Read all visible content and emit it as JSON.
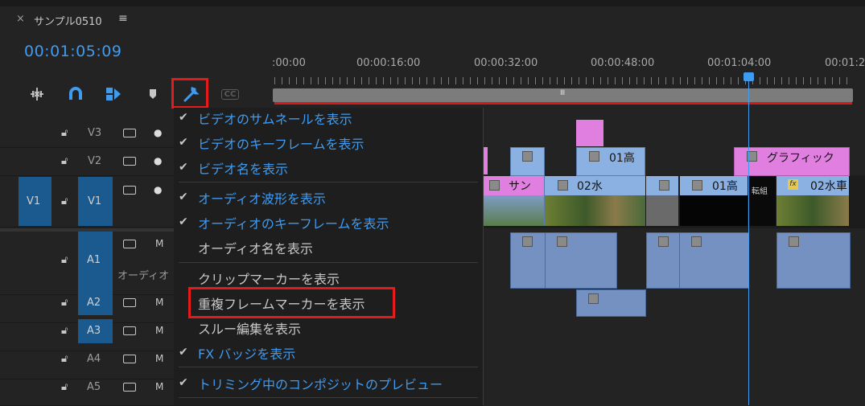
{
  "sequence_tab": {
    "close": "×",
    "title": "サンプル0510",
    "menu": "≡"
  },
  "timecode": "00:01:05:09",
  "ruler": {
    "labels": [
      ":00:00",
      "00:00:16:00",
      "00:00:32:00",
      "00:00:48:00",
      "00:01:04:00",
      "00:01:2"
    ],
    "scroll_grip": "Ⅲ"
  },
  "toolbar": {
    "snap": "snap-icon",
    "magnet": "magnet-icon",
    "linked": "linked-selection-icon",
    "marker": "add-marker-icon",
    "settings": "wrench-icon",
    "captions_label": "CC"
  },
  "tracks": {
    "video": [
      {
        "name": "V3"
      },
      {
        "name": "V2"
      },
      {
        "name": "V1",
        "source": "V1"
      }
    ],
    "audio": [
      {
        "name": "A1",
        "m": "M",
        "label": "オーディオ"
      },
      {
        "name": "A2",
        "m": "M"
      },
      {
        "name": "A3",
        "m": "M"
      },
      {
        "name": "A4",
        "m": "M"
      },
      {
        "name": "A5",
        "m": "M"
      }
    ]
  },
  "settings_menu": {
    "items": [
      {
        "label": "ビデオのサムネールを表示",
        "checked": true
      },
      {
        "label": "ビデオのキーフレームを表示",
        "checked": true
      },
      {
        "label": "ビデオ名を表示",
        "checked": true
      },
      {
        "label": "オーディオ波形を表示",
        "checked": true
      },
      {
        "label": "オーディオのキーフレームを表示",
        "checked": true
      },
      {
        "label": "オーディオ名を表示",
        "checked": false
      },
      {
        "label": "クリップマーカーを表示",
        "checked": false
      },
      {
        "label": "重複フレームマーカーを表示",
        "checked": false
      },
      {
        "label": "スルー編集を表示",
        "checked": false
      },
      {
        "label": "FX バッジを表示",
        "checked": true
      },
      {
        "label": "トリミング中のコンポジットのプレビュー",
        "checked": true
      }
    ]
  },
  "clips": {
    "v2_a": "01高",
    "v2_graphic": "グラフィック",
    "v1_a": "サン",
    "v1_b": "02水",
    "v1_c": "01高",
    "v1_d": "転組",
    "v1_e": "02水車",
    "fx": "fx"
  },
  "colors": {
    "accent": "#3f9bef",
    "highlight": "#e51b1b",
    "clip_video": "#8bb1e3",
    "clip_pink": "#e07fe0",
    "clip_audio": "#7591c2"
  }
}
